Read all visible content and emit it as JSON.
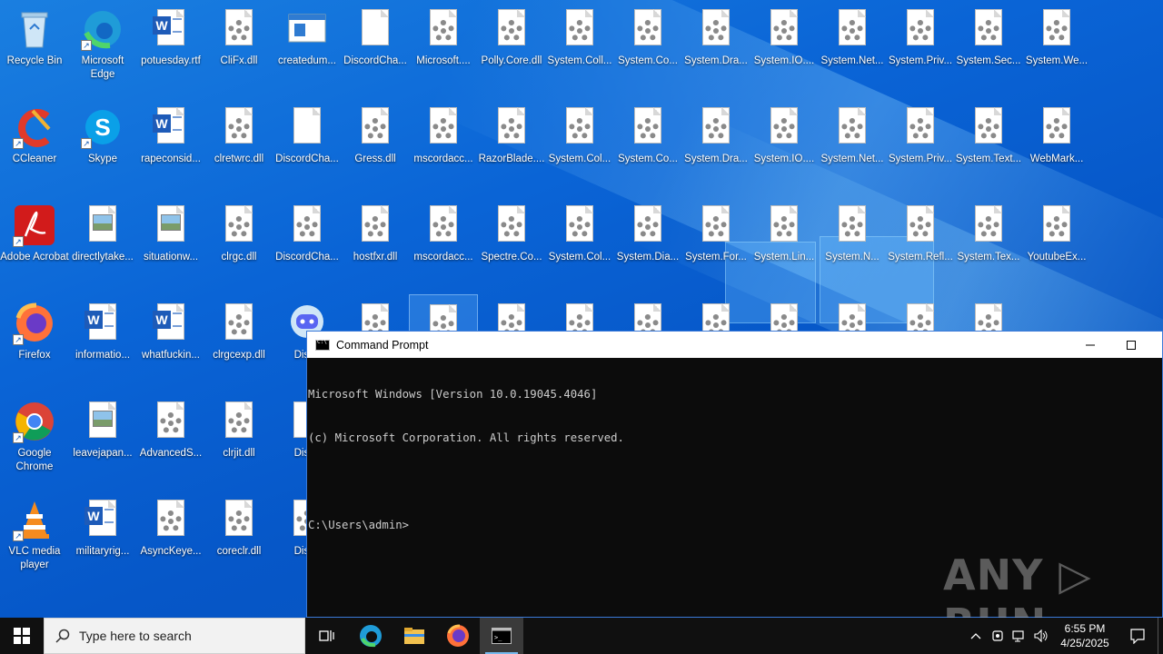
{
  "desktop": {
    "icons": [
      {
        "label": "Recycle Bin",
        "icon": "recycle-bin-icon"
      },
      {
        "label": "Microsoft Edge",
        "icon": "edge-icon"
      },
      {
        "label": "potuesday.rtf",
        "icon": "word-doc-icon"
      },
      {
        "label": "CliFx.dll",
        "icon": "dll-file-icon"
      },
      {
        "label": "createdum...",
        "icon": "exe-window-icon"
      },
      {
        "label": "DiscordCha...",
        "icon": "blank-file-icon"
      },
      {
        "label": "Microsoft....",
        "icon": "dll-file-icon"
      },
      {
        "label": "Polly.Core.dll",
        "icon": "dll-file-icon"
      },
      {
        "label": "System.Coll...",
        "icon": "dll-file-icon"
      },
      {
        "label": "System.Co...",
        "icon": "dll-file-icon"
      },
      {
        "label": "System.Dra...",
        "icon": "dll-file-icon"
      },
      {
        "label": "System.IO....",
        "icon": "dll-file-icon"
      },
      {
        "label": "System.Net...",
        "icon": "dll-file-icon"
      },
      {
        "label": "System.Priv...",
        "icon": "dll-file-icon"
      },
      {
        "label": "System.Sec...",
        "icon": "dll-file-icon"
      },
      {
        "label": "System.We...",
        "icon": "dll-file-icon"
      },
      {
        "label": "CCleaner",
        "icon": "ccleaner-icon"
      },
      {
        "label": "Skype",
        "icon": "skype-icon"
      },
      {
        "label": "rapeconsid...",
        "icon": "word-doc-icon"
      },
      {
        "label": "clretwrc.dll",
        "icon": "dll-file-icon"
      },
      {
        "label": "DiscordCha...",
        "icon": "blank-file-icon"
      },
      {
        "label": "Gress.dll",
        "icon": "dll-file-icon"
      },
      {
        "label": "mscordacc...",
        "icon": "dll-file-icon"
      },
      {
        "label": "RazorBlade....",
        "icon": "dll-file-icon"
      },
      {
        "label": "System.Col...",
        "icon": "dll-file-icon"
      },
      {
        "label": "System.Co...",
        "icon": "dll-file-icon"
      },
      {
        "label": "System.Dra...",
        "icon": "dll-file-icon"
      },
      {
        "label": "System.IO....",
        "icon": "dll-file-icon"
      },
      {
        "label": "System.Net...",
        "icon": "dll-file-icon"
      },
      {
        "label": "System.Priv...",
        "icon": "dll-file-icon"
      },
      {
        "label": "System.Text...",
        "icon": "dll-file-icon"
      },
      {
        "label": "WebMark...",
        "icon": "dll-file-icon"
      },
      {
        "label": "Adobe Acrobat",
        "icon": "acrobat-icon"
      },
      {
        "label": "directlytake...",
        "icon": "image-file-icon"
      },
      {
        "label": "situationw...",
        "icon": "image-file-icon"
      },
      {
        "label": "clrgc.dll",
        "icon": "dll-file-icon"
      },
      {
        "label": "DiscordCha...",
        "icon": "dll-file-icon"
      },
      {
        "label": "hostfxr.dll",
        "icon": "dll-file-icon"
      },
      {
        "label": "mscordacc...",
        "icon": "dll-file-icon"
      },
      {
        "label": "Spectre.Co...",
        "icon": "dll-file-icon"
      },
      {
        "label": "System.Col...",
        "icon": "dll-file-icon"
      },
      {
        "label": "System.Dia...",
        "icon": "dll-file-icon"
      },
      {
        "label": "System.For...",
        "icon": "dll-file-icon"
      },
      {
        "label": "System.Lin...",
        "icon": "dll-file-icon"
      },
      {
        "label": "System.N...",
        "icon": "dll-file-icon"
      },
      {
        "label": "System.Refl...",
        "icon": "dll-file-icon"
      },
      {
        "label": "System.Tex...",
        "icon": "dll-file-icon"
      },
      {
        "label": "YoutubeEx...",
        "icon": "dll-file-icon"
      },
      {
        "label": "Firefox",
        "icon": "firefox-icon"
      },
      {
        "label": "informatio...",
        "icon": "word-doc-icon"
      },
      {
        "label": "whatfuckin...",
        "icon": "word-doc-icon"
      },
      {
        "label": "clrgcexp.dll",
        "icon": "dll-file-icon"
      },
      {
        "label": "Disco",
        "icon": "discord-icon"
      },
      {
        "label": "",
        "icon": "dll-file-icon"
      },
      {
        "label": "",
        "icon": "dll-file-icon"
      },
      {
        "label": "",
        "icon": "dll-file-icon"
      },
      {
        "label": "",
        "icon": "dll-file-icon"
      },
      {
        "label": "",
        "icon": "dll-file-icon"
      },
      {
        "label": "",
        "icon": "dll-file-icon"
      },
      {
        "label": "",
        "icon": "dll-file-icon"
      },
      {
        "label": "",
        "icon": "dll-file-icon"
      },
      {
        "label": "",
        "icon": "dll-file-icon"
      },
      {
        "label": "",
        "icon": "dll-file-icon"
      },
      {
        "label": "Google Chrome",
        "icon": "chrome-icon"
      },
      {
        "label": "leavejapan...",
        "icon": "image-file-icon"
      },
      {
        "label": "AdvancedS...",
        "icon": "dll-file-icon"
      },
      {
        "label": "clrjit.dll",
        "icon": "dll-file-icon"
      },
      {
        "label": "Disco",
        "icon": "blank-file-icon"
      },
      {
        "label": "VLC media player",
        "icon": "vlc-icon"
      },
      {
        "label": "militaryrig...",
        "icon": "word-doc-icon"
      },
      {
        "label": "AsyncKeye...",
        "icon": "dll-file-icon"
      },
      {
        "label": "coreclr.dll",
        "icon": "dll-file-icon"
      },
      {
        "label": "Disco",
        "icon": "dll-file-icon"
      }
    ]
  },
  "cmd_window": {
    "title": "Command Prompt",
    "minimize_glyph": "—",
    "maximize_glyph": "☐",
    "lines": [
      "Microsoft Windows [Version 10.0.19045.4046]",
      "(c) Microsoft Corporation. All rights reserved.",
      "",
      "C:\\Users\\admin>"
    ]
  },
  "watermark": "ANY ▷ RUN",
  "taskbar": {
    "search_placeholder": "Type here to search",
    "clock_time": "6:55 PM",
    "clock_date": "4/25/2025",
    "pinned": [
      "task-view-icon",
      "edge-icon",
      "file-explorer-icon",
      "firefox-icon",
      "cmd-icon"
    ],
    "tray": [
      "chevron-up-icon",
      "security-icon",
      "network-icon",
      "volume-icon"
    ]
  },
  "colors": {
    "desktop_blue": "#0a64d6",
    "taskbar": "#101010",
    "cmd_bg": "#0c0c0c",
    "cmd_text": "#cccccc",
    "accent": "#76b9ed"
  }
}
